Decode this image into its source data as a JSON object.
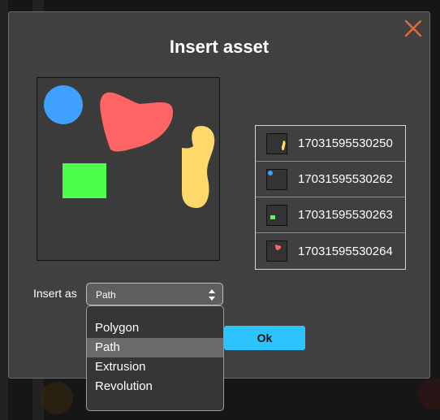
{
  "dialog": {
    "title": "Insert asset"
  },
  "assets": [
    {
      "name": "17031595530250",
      "shape": "yellow-path"
    },
    {
      "name": "17031595530262",
      "shape": "blue-circle"
    },
    {
      "name": "17031595530263",
      "shape": "green-rect"
    },
    {
      "name": "17031595530264",
      "shape": "red-blob"
    }
  ],
  "insert_as": {
    "label": "Insert as",
    "value": "Path",
    "options": [
      "Polygon",
      "Path",
      "Extrusion",
      "Revolution"
    ],
    "selected_index": 1
  },
  "ok_label": "Ok",
  "colors": {
    "blue": "#3fa0ff",
    "red": "#ff6464",
    "green": "#4cff4c",
    "yellow": "#ffd86a",
    "accent": "#2cc3ff",
    "close": "#e06a3a"
  }
}
